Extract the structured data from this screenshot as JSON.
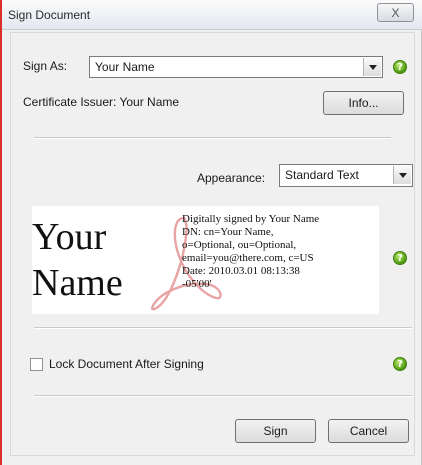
{
  "window": {
    "title": "Sign Document",
    "close_glyph": "X"
  },
  "sign_as": {
    "label": "Sign As:",
    "value": "Your Name"
  },
  "certificate": {
    "label": "Certificate Issuer: Your Name",
    "info_button": "Info..."
  },
  "appearance": {
    "label": "Appearance:",
    "value": "Standard Text"
  },
  "preview": {
    "name_line1": "Your",
    "name_line2": "Name",
    "details": [
      "Digitally signed by Your Name",
      "DN: cn=Your Name,",
      "o=Optional, ou=Optional,",
      "email=you@there.com, c=US",
      "Date: 2010.03.01 08:13:38",
      "-05'00'"
    ]
  },
  "lock": {
    "label": "Lock Document After Signing",
    "checked": false
  },
  "buttons": {
    "sign": "Sign",
    "cancel": "Cancel"
  },
  "help_glyph": "?",
  "colors": {
    "window_border": "#d9302c",
    "help_icon": "#4d9a0f",
    "logo_watermark": "#e8a3a3"
  }
}
